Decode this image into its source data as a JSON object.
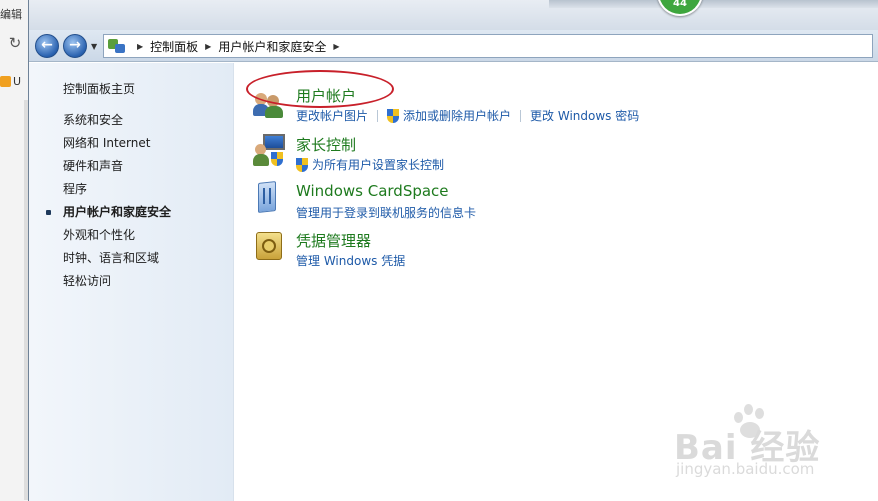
{
  "background_browser": {
    "title_fragment": "编辑",
    "refresh_icon": "refresh-icon",
    "bookmark_text": "U"
  },
  "window": {
    "titlebar_faded_text": "",
    "badge_value": "44"
  },
  "navbar": {
    "back_icon": "back-arrow-icon",
    "forward_icon": "forward-arrow-icon",
    "breadcrumbs": [
      "控制面板",
      "用户帐户和家庭安全"
    ]
  },
  "left_pane": {
    "home": "控制面板主页",
    "items": [
      {
        "label": "系统和安全",
        "active": false
      },
      {
        "label": "网络和 Internet",
        "active": false
      },
      {
        "label": "硬件和声音",
        "active": false
      },
      {
        "label": "程序",
        "active": false
      },
      {
        "label": "用户帐户和家庭安全",
        "active": true
      },
      {
        "label": "外观和个性化",
        "active": false
      },
      {
        "label": "时钟、语言和区域",
        "active": false
      },
      {
        "label": "轻松访问",
        "active": false
      }
    ]
  },
  "categories": [
    {
      "title": "用户帐户",
      "icon": "user-accounts-icon",
      "links": [
        "更改帐户图片",
        "添加或删除用户帐户",
        "更改 Windows 密码"
      ]
    },
    {
      "title": "家长控制",
      "icon": "parental-controls-icon",
      "links": [
        "为所有用户设置家长控制"
      ]
    },
    {
      "title": "Windows CardSpace",
      "icon": "cardspace-icon",
      "links": [
        "管理用于登录到联机服务的信息卡"
      ]
    },
    {
      "title": "凭据管理器",
      "icon": "credential-manager-icon",
      "links": [
        "管理 Windows 凭据"
      ]
    }
  ],
  "annotation": {
    "highlight_color": "#c8202a"
  },
  "watermark": {
    "brand": "Bai  经验",
    "url": "jingyan.baidu.com"
  },
  "colors": {
    "category_title": "#1e7a1e",
    "link": "#1e5aa8"
  }
}
